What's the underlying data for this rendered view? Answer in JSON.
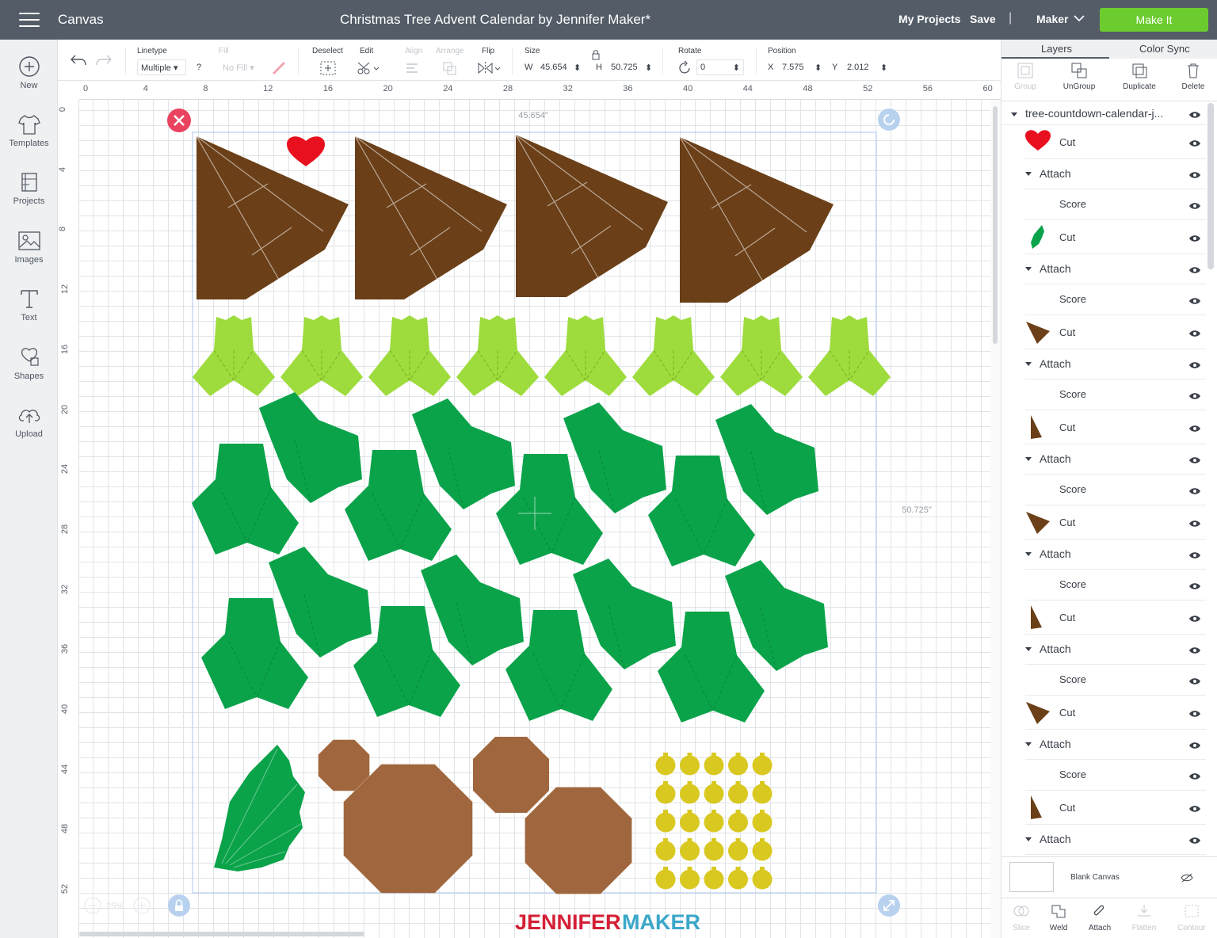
{
  "topbar": {
    "canvas_label": "Canvas",
    "document_title": "Christmas Tree Advent Calendar by Jennifer Maker*",
    "my_projects": "My Projects",
    "save": "Save",
    "separator": "|",
    "machine": "Maker",
    "make_it": "Make It"
  },
  "leftnav": {
    "items": [
      {
        "label": "New",
        "icon": "plus-circle-icon"
      },
      {
        "label": "Templates",
        "icon": "tshirt-icon"
      },
      {
        "label": "Projects",
        "icon": "projects-icon"
      },
      {
        "label": "Images",
        "icon": "image-icon"
      },
      {
        "label": "Text",
        "icon": "text-icon"
      },
      {
        "label": "Shapes",
        "icon": "shapes-icon"
      },
      {
        "label": "Upload",
        "icon": "cloud-upload-icon"
      }
    ]
  },
  "toolbar": {
    "linetype_label": "Linetype",
    "linetype_value": "Multiple",
    "fill_label": "Fill",
    "fill_value": "No Fill",
    "question": "?",
    "deselect_label": "Deselect",
    "edit_label": "Edit",
    "align_label": "Align",
    "arrange_label": "Arrange",
    "flip_label": "Flip",
    "size_label": "Size",
    "w_label": "W",
    "w_value": "45.654",
    "h_label": "H",
    "h_value": "50.725",
    "rotate_label": "Rotate",
    "rotate_value": "0",
    "position_label": "Position",
    "x_label": "X",
    "x_value": "7.575",
    "y_label": "Y",
    "y_value": "2.012"
  },
  "rulers": {
    "top": [
      "0",
      "4",
      "8",
      "12",
      "16",
      "20",
      "24",
      "28",
      "32",
      "36",
      "40",
      "44",
      "48",
      "52",
      "56",
      "60"
    ],
    "left": [
      "0",
      "4",
      "8",
      "12",
      "16",
      "20",
      "24",
      "28",
      "32",
      "36",
      "40",
      "44",
      "48",
      "52"
    ]
  },
  "canvas": {
    "width_dimension": "45.654\"",
    "height_dimension": "50.725\"",
    "zoom": "25%",
    "watermark_part1": "JENNIFER",
    "watermark_part2": "MAKER",
    "colors": {
      "trunk": "#6b3f17",
      "light_green": "#9edb3c",
      "dark_green": "#0aa34a",
      "tan": "#a0673e",
      "gold": "#d9c81f",
      "heart": "#e8101e",
      "selection": "#a9c6e8"
    }
  },
  "rightpanel": {
    "tab_layers": "Layers",
    "tab_colorsync": "Color Sync",
    "actions": [
      {
        "label": "Group",
        "enabled": false
      },
      {
        "label": "UnGroup",
        "enabled": true
      },
      {
        "label": "Duplicate",
        "enabled": true
      },
      {
        "label": "Delete",
        "enabled": true
      }
    ],
    "group_name": "tree-countdown-calendar-j...",
    "layers": [
      {
        "kind": "item",
        "label": "Cut",
        "thumb": "heart"
      },
      {
        "kind": "attach",
        "label": "Attach"
      },
      {
        "kind": "score",
        "label": "Score"
      },
      {
        "kind": "item",
        "label": "Cut",
        "thumb": "leaf"
      },
      {
        "kind": "attach",
        "label": "Attach"
      },
      {
        "kind": "score",
        "label": "Score"
      },
      {
        "kind": "item",
        "label": "Cut",
        "thumb": "trunk"
      },
      {
        "kind": "attach",
        "label": "Attach"
      },
      {
        "kind": "score",
        "label": "Score"
      },
      {
        "kind": "item",
        "label": "Cut",
        "thumb": "trunk-tall"
      },
      {
        "kind": "attach",
        "label": "Attach"
      },
      {
        "kind": "score",
        "label": "Score"
      },
      {
        "kind": "item",
        "label": "Cut",
        "thumb": "trunk"
      },
      {
        "kind": "attach",
        "label": "Attach"
      },
      {
        "kind": "score",
        "label": "Score"
      },
      {
        "kind": "item",
        "label": "Cut",
        "thumb": "trunk-tall"
      },
      {
        "kind": "attach",
        "label": "Attach"
      },
      {
        "kind": "score",
        "label": "Score"
      },
      {
        "kind": "item",
        "label": "Cut",
        "thumb": "trunk"
      },
      {
        "kind": "attach",
        "label": "Attach"
      },
      {
        "kind": "score",
        "label": "Score"
      },
      {
        "kind": "item",
        "label": "Cut",
        "thumb": "trunk-tall"
      },
      {
        "kind": "attach",
        "label": "Attach"
      }
    ],
    "blank_canvas": "Blank Canvas",
    "bottom_tools": [
      {
        "label": "Slice",
        "enabled": false
      },
      {
        "label": "Weld",
        "enabled": true
      },
      {
        "label": "Attach",
        "enabled": true
      },
      {
        "label": "Flatten",
        "enabled": false
      },
      {
        "label": "Contour",
        "enabled": false
      }
    ]
  }
}
